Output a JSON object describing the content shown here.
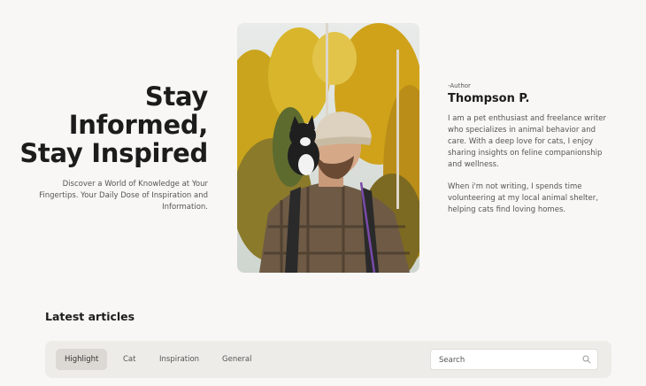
{
  "hero": {
    "title_line1": "Stay",
    "title_line2": "Informed,",
    "title_line3": "Stay Inspired",
    "subtitle": "Discover a World of Knowledge at Your Fingertips. Your Daily Dose of Inspiration and Information."
  },
  "author": {
    "tag": "-Author",
    "name": "Thompson P.",
    "bio_paragraph1": "I am a pet enthusiast and freelance writer who specializes in animal behavior and care. With a deep love for cats, I enjoy sharing insights on feline companionship and wellness.",
    "bio_paragraph2": "When i'm not writing, I spends time volunteering at my local animal shelter, helping cats find loving homes."
  },
  "articles": {
    "section_title": "Latest articles",
    "tabs": [
      {
        "label": "Highlight",
        "active": true
      },
      {
        "label": "Cat",
        "active": false
      },
      {
        "label": "Inspiration",
        "active": false
      },
      {
        "label": "General",
        "active": false
      }
    ],
    "search_placeholder": "Search"
  },
  "colors": {
    "background": "#f8f7f5",
    "filter_bar": "#eeece8",
    "active_tab": "#dcd9d4",
    "text_dark": "#1c1c1c",
    "text_muted": "#555555"
  },
  "icons": {
    "search": "search-icon"
  }
}
